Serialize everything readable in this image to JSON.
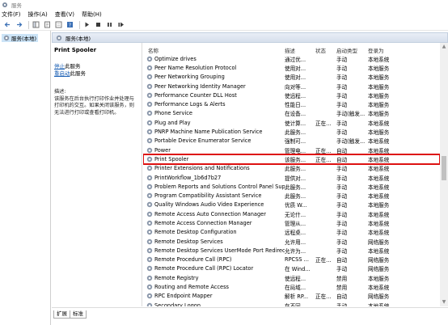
{
  "window": {
    "title": "服务"
  },
  "menu": [
    "文件(F)",
    "操作(A)",
    "查看(V)",
    "帮助(H)"
  ],
  "nav": {
    "root": "服务(本地)"
  },
  "panel": {
    "header": "服务(本地)"
  },
  "description": {
    "service_name": "Print Spooler",
    "stop_link": "停止",
    "stop_suffix": "此服务",
    "restart_link": "重启动",
    "restart_suffix": "此服务",
    "label": "描述:",
    "text": "该服务在后台执行打印作业并处理与打印机的交互。如果关闭该服务，则无法进行打印或查看打印机。"
  },
  "columns": {
    "name": "名称",
    "desc": "描述",
    "status": "状态",
    "startup": "启动类型",
    "logon": "登录为"
  },
  "services": [
    {
      "name": "Optimize drives",
      "desc": "通过优...",
      "status": "",
      "startup": "手动",
      "logon": "本地系统"
    },
    {
      "name": "Peer Name Resolution Protocol",
      "desc": "使用对...",
      "status": "",
      "startup": "手动",
      "logon": "本地服务"
    },
    {
      "name": "Peer Networking Grouping",
      "desc": "使用对...",
      "status": "",
      "startup": "手动",
      "logon": "本地服务"
    },
    {
      "name": "Peer Networking Identity Manager",
      "desc": "向对等...",
      "status": "",
      "startup": "手动",
      "logon": "本地服务"
    },
    {
      "name": "Performance Counter DLL Host",
      "desc": "使远程...",
      "status": "",
      "startup": "手动",
      "logon": "本地服务"
    },
    {
      "name": "Performance Logs & Alerts",
      "desc": "性能日...",
      "status": "",
      "startup": "手动",
      "logon": "本地服务"
    },
    {
      "name": "Phone Service",
      "desc": "在设备...",
      "status": "",
      "startup": "手动(触发...",
      "logon": "本地服务"
    },
    {
      "name": "Plug and Play",
      "desc": "使计算...",
      "status": "正在...",
      "startup": "手动",
      "logon": "本地系统"
    },
    {
      "name": "PNRP Machine Name Publication Service",
      "desc": "此服务...",
      "status": "",
      "startup": "手动",
      "logon": "本地服务"
    },
    {
      "name": "Portable Device Enumerator Service",
      "desc": "强制可...",
      "status": "",
      "startup": "手动(触发...",
      "logon": "本地系统"
    },
    {
      "name": "Power",
      "desc": "管理电...",
      "status": "正在...",
      "startup": "自动",
      "logon": "本地系统"
    },
    {
      "name": "Print Spooler",
      "desc": "该服务...",
      "status": "正在...",
      "startup": "自动",
      "logon": "本地系统"
    },
    {
      "name": "Printer Extensions and Notifications",
      "desc": "此服务...",
      "status": "",
      "startup": "手动",
      "logon": "本地系统"
    },
    {
      "name": "PrintWorkflow_1b6d7b27",
      "desc": "提供对...",
      "status": "",
      "startup": "手动",
      "logon": "本地系统"
    },
    {
      "name": "Problem Reports and Solutions Control Panel Supp...",
      "desc": "此服务...",
      "status": "",
      "startup": "手动",
      "logon": "本地系统"
    },
    {
      "name": "Program Compatibility Assistant Service",
      "desc": "此服务...",
      "status": "",
      "startup": "手动",
      "logon": "本地系统"
    },
    {
      "name": "Quality Windows Audio Video Experience",
      "desc": "优质 W...",
      "status": "",
      "startup": "手动",
      "logon": "本地服务"
    },
    {
      "name": "Remote Access Auto Connection Manager",
      "desc": "无论什...",
      "status": "",
      "startup": "手动",
      "logon": "本地系统"
    },
    {
      "name": "Remote Access Connection Manager",
      "desc": "管理从...",
      "status": "",
      "startup": "手动",
      "logon": "本地系统"
    },
    {
      "name": "Remote Desktop Configuration",
      "desc": "远程桌...",
      "status": "",
      "startup": "手动",
      "logon": "本地系统"
    },
    {
      "name": "Remote Desktop Services",
      "desc": "允许用...",
      "status": "",
      "startup": "手动",
      "logon": "网络服务"
    },
    {
      "name": "Remote Desktop Services UserMode Port Redirector",
      "desc": "允许为...",
      "status": "",
      "startup": "手动",
      "logon": "本地系统"
    },
    {
      "name": "Remote Procedure Call (RPC)",
      "desc": "RPCSS ...",
      "status": "正在...",
      "startup": "自动",
      "logon": "网络服务"
    },
    {
      "name": "Remote Procedure Call (RPC) Locator",
      "desc": "在 Wind...",
      "status": "",
      "startup": "手动",
      "logon": "网络服务"
    },
    {
      "name": "Remote Registry",
      "desc": "使远程...",
      "status": "",
      "startup": "禁用",
      "logon": "本地服务"
    },
    {
      "name": "Routing and Remote Access",
      "desc": "在局域...",
      "status": "",
      "startup": "禁用",
      "logon": "本地系统"
    },
    {
      "name": "RPC Endpoint Mapper",
      "desc": "解析 RP...",
      "status": "正在...",
      "startup": "自动",
      "logon": "网络服务"
    },
    {
      "name": "Secondary Logon",
      "desc": "在不同...",
      "status": "",
      "startup": "手动",
      "logon": "本地系统"
    }
  ],
  "selected_index": 11,
  "tabs": [
    "扩展",
    "标准"
  ]
}
